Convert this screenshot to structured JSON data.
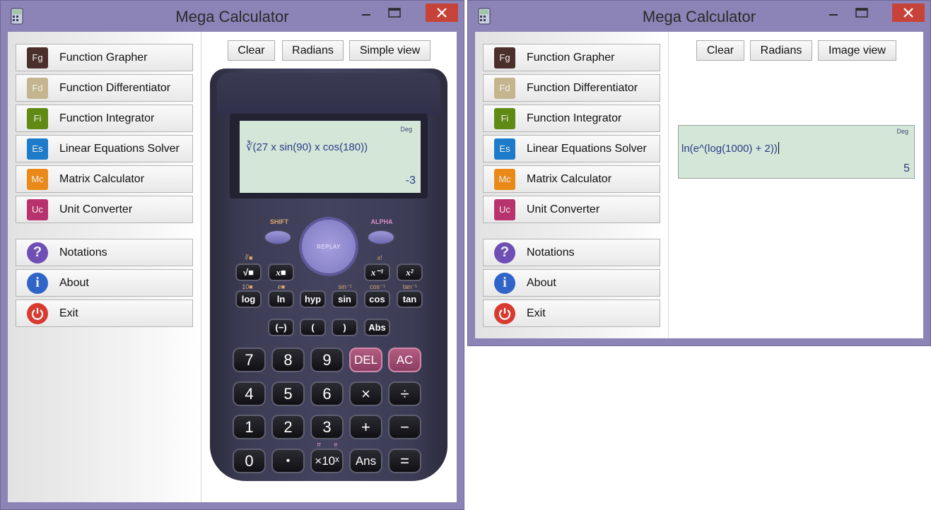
{
  "window_title": "Mega Calculator",
  "sidebar": {
    "items": [
      {
        "label": "Function Grapher",
        "icon": "FG",
        "color": "#4a2f2b"
      },
      {
        "label": "Function Differentiator",
        "icon": "FD",
        "color": "#c5b58f"
      },
      {
        "label": "Function Integrator",
        "icon": "FI",
        "color": "#5f8a14"
      },
      {
        "label": "Linear Equations Solver",
        "icon": "ES",
        "color": "#1d7bc9"
      },
      {
        "label": "Matrix Calculator",
        "icon": "MC",
        "color": "#e98a18"
      },
      {
        "label": "Unit Converter",
        "icon": "UC",
        "color": "#b8336d"
      }
    ],
    "extras": [
      {
        "label": "Notations",
        "icon": "question-icon",
        "color": "#6f4fb5"
      },
      {
        "label": "About",
        "icon": "info-icon",
        "color": "#2f64c8"
      },
      {
        "label": "Exit",
        "icon": "power-icon",
        "color": "#d93a2f"
      }
    ]
  },
  "window1": {
    "buttons": {
      "clear": "Clear",
      "radians": "Radians",
      "view": "Simple view"
    },
    "lcd": {
      "mode": "Deg",
      "expression": "∛(27 x sin(90) x cos(180))",
      "result": "-3"
    }
  },
  "window2": {
    "buttons": {
      "clear": "Clear",
      "radians": "Radians",
      "view": "Image view"
    },
    "display": {
      "mode": "Deg",
      "expression": "ln(e^(log(1000) + 2))",
      "result": "5"
    }
  },
  "calculator_keys": {
    "shift": "SHIFT",
    "alpha": "ALPHA",
    "replay": "REPLAY",
    "row1": [
      {
        "key": "√■",
        "above": "∛■"
      },
      {
        "key": "x■",
        "above": ""
      },
      {
        "key": "x⁻¹",
        "above": "x!"
      },
      {
        "key": "x²",
        "above": ""
      }
    ],
    "row2": [
      {
        "key": "log",
        "above": "10■"
      },
      {
        "key": "ln",
        "above": "e■"
      },
      {
        "key": "hyp",
        "above": ""
      },
      {
        "key": "sin",
        "above": "sin⁻¹"
      },
      {
        "key": "cos",
        "above": "cos⁻¹"
      },
      {
        "key": "tan",
        "above": "tan⁻¹"
      }
    ],
    "row3": [
      "(−)",
      "(",
      ")",
      "Abs"
    ],
    "num_rows": [
      [
        "7",
        "8",
        "9",
        "DEL",
        "AC"
      ],
      [
        "4",
        "5",
        "6",
        "×",
        "÷"
      ],
      [
        "1",
        "2",
        "3",
        "+",
        "−"
      ],
      [
        "0",
        "•",
        "×10ˣ",
        "Ans",
        "="
      ]
    ],
    "pi_label": "π",
    "e_label": "e"
  }
}
